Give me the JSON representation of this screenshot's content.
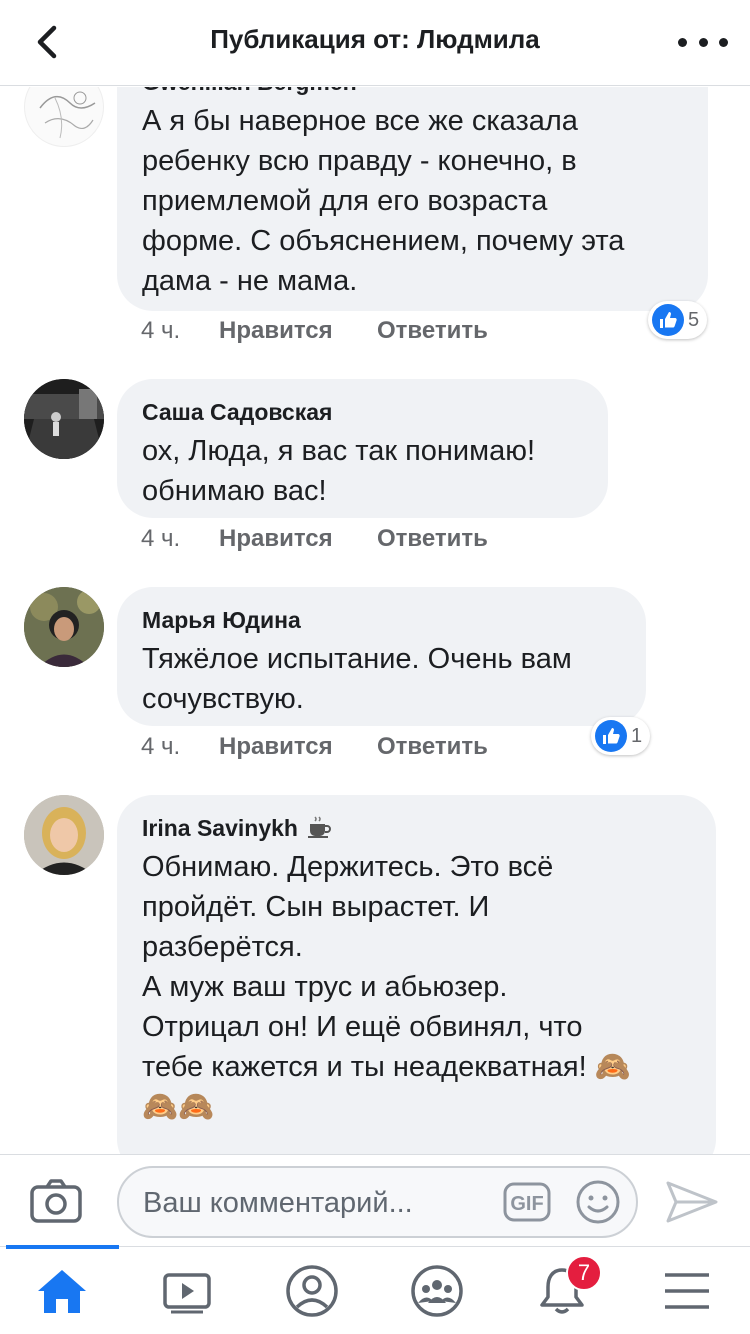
{
  "header": {
    "title": "Публикация от: Людмила"
  },
  "comments": [
    {
      "author": "Gwenllian Bergmen",
      "text": "А я бы наверное все же сказала\nребенку всю правду - конечно, в\nприемлемой для его возраста\nформе. С объяснением, почему эта\nдама - не мама.",
      "time": "4 ч.",
      "like_label": "Нравится",
      "reply_label": "Ответить",
      "reactions": "5"
    },
    {
      "author": "Саша Садовская",
      "text": "ох, Люда, я вас так понимаю!\nобнимаю вас!",
      "time": "4 ч.",
      "like_label": "Нравится",
      "reply_label": "Ответить"
    },
    {
      "author": "Марья Юдина",
      "text": "Тяжёлое испытание. Очень вам\nсочувствую.",
      "time": "4 ч.",
      "like_label": "Нравится",
      "reply_label": "Ответить",
      "reactions": "1"
    },
    {
      "author": "Irina Savinykh",
      "author_icon": "coffee-icon",
      "text": "Обнимаю. Держитесь. Это всё\nпройдёт. Сын вырастет. И\nразберётся.\nА муж ваш трус и абьюзер.\nОтрицал он! И ещё обвинял, что\nтебе кажется и ты неадекватная! 🙈\n🙈🙈"
    }
  ],
  "composer": {
    "placeholder": "Ваш комментарий...",
    "gif_label": "GIF"
  },
  "tabbar": {
    "notification_count": "7",
    "active_tab": "home",
    "accent": "#1877f2"
  }
}
